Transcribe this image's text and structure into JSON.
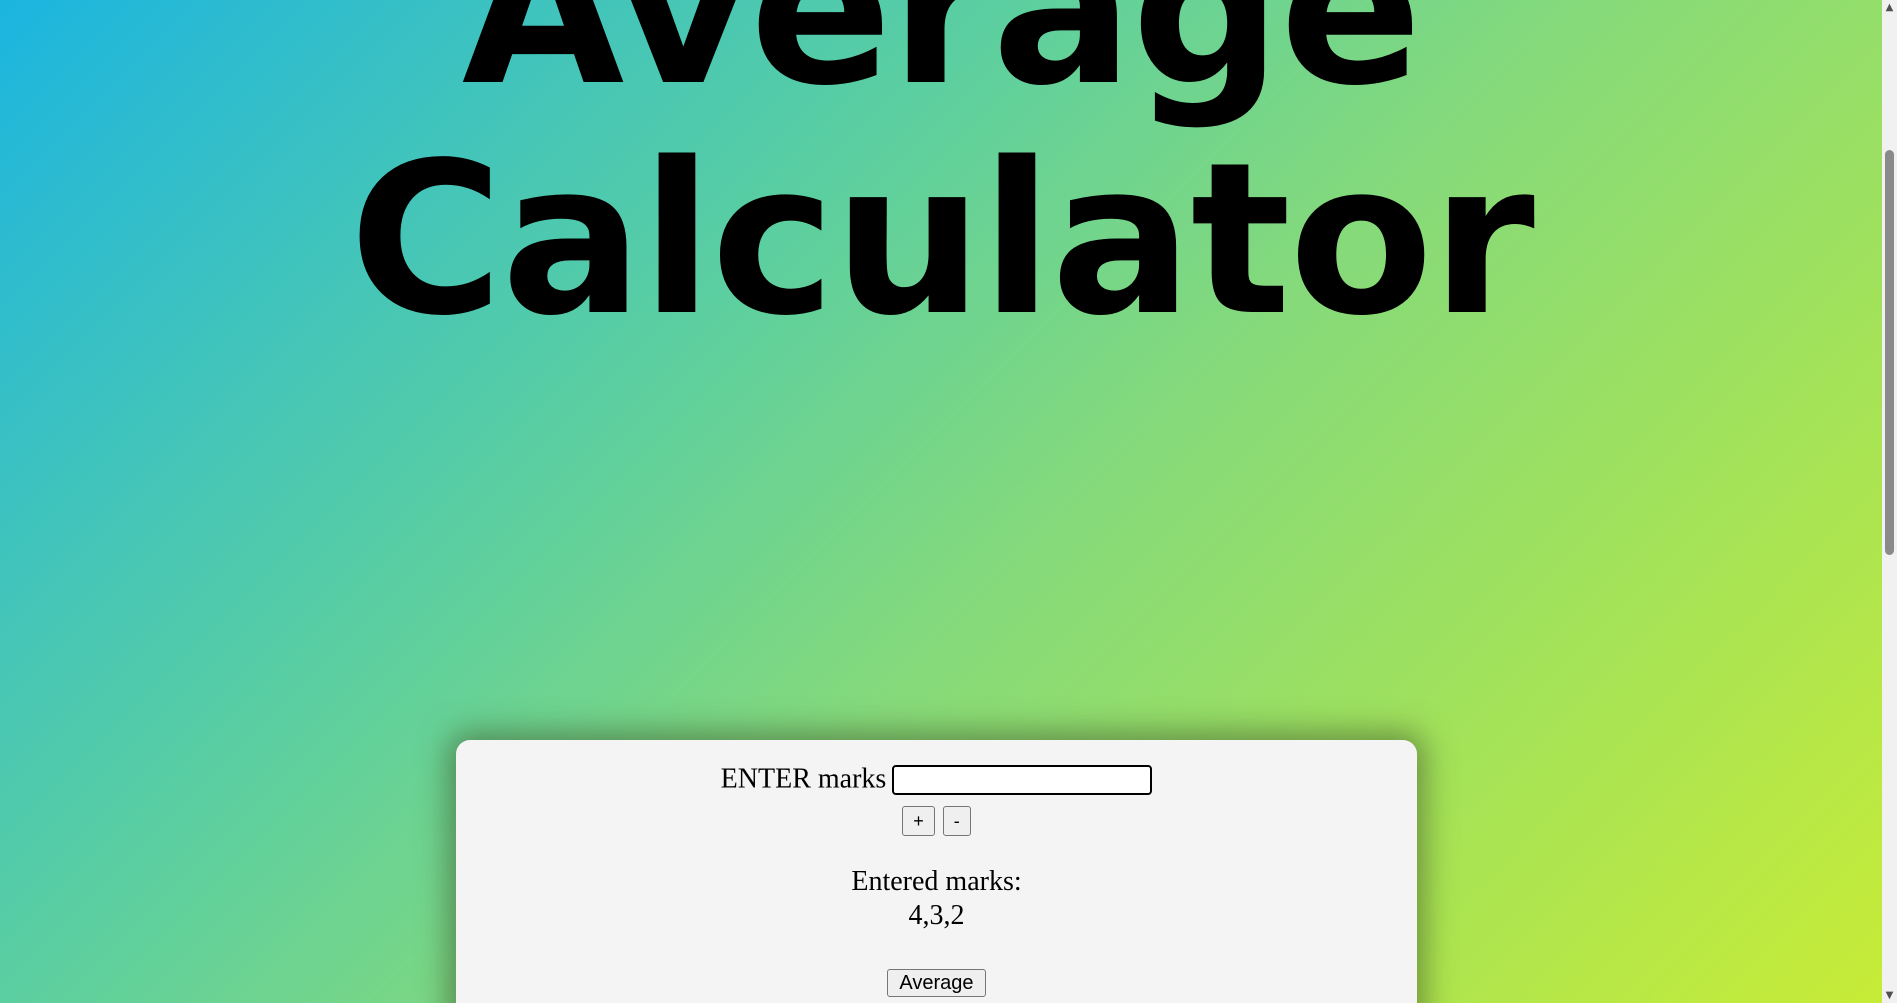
{
  "title": {
    "line1": "Average",
    "line2": "Calculator"
  },
  "form": {
    "enter_label": "ENTER marks",
    "input_value": "",
    "plus_label": "+",
    "minus_label": "-",
    "entered_label": "Entered marks:",
    "entered_values": "4,3,2",
    "average_label": "Average"
  },
  "scrollbar": {
    "up_icon": "▲",
    "down_icon": "▼"
  },
  "colors": {
    "gradient_start": "#1cb5e0",
    "gradient_end": "#c8ec36",
    "panel_bg": "#f4f4f4"
  }
}
